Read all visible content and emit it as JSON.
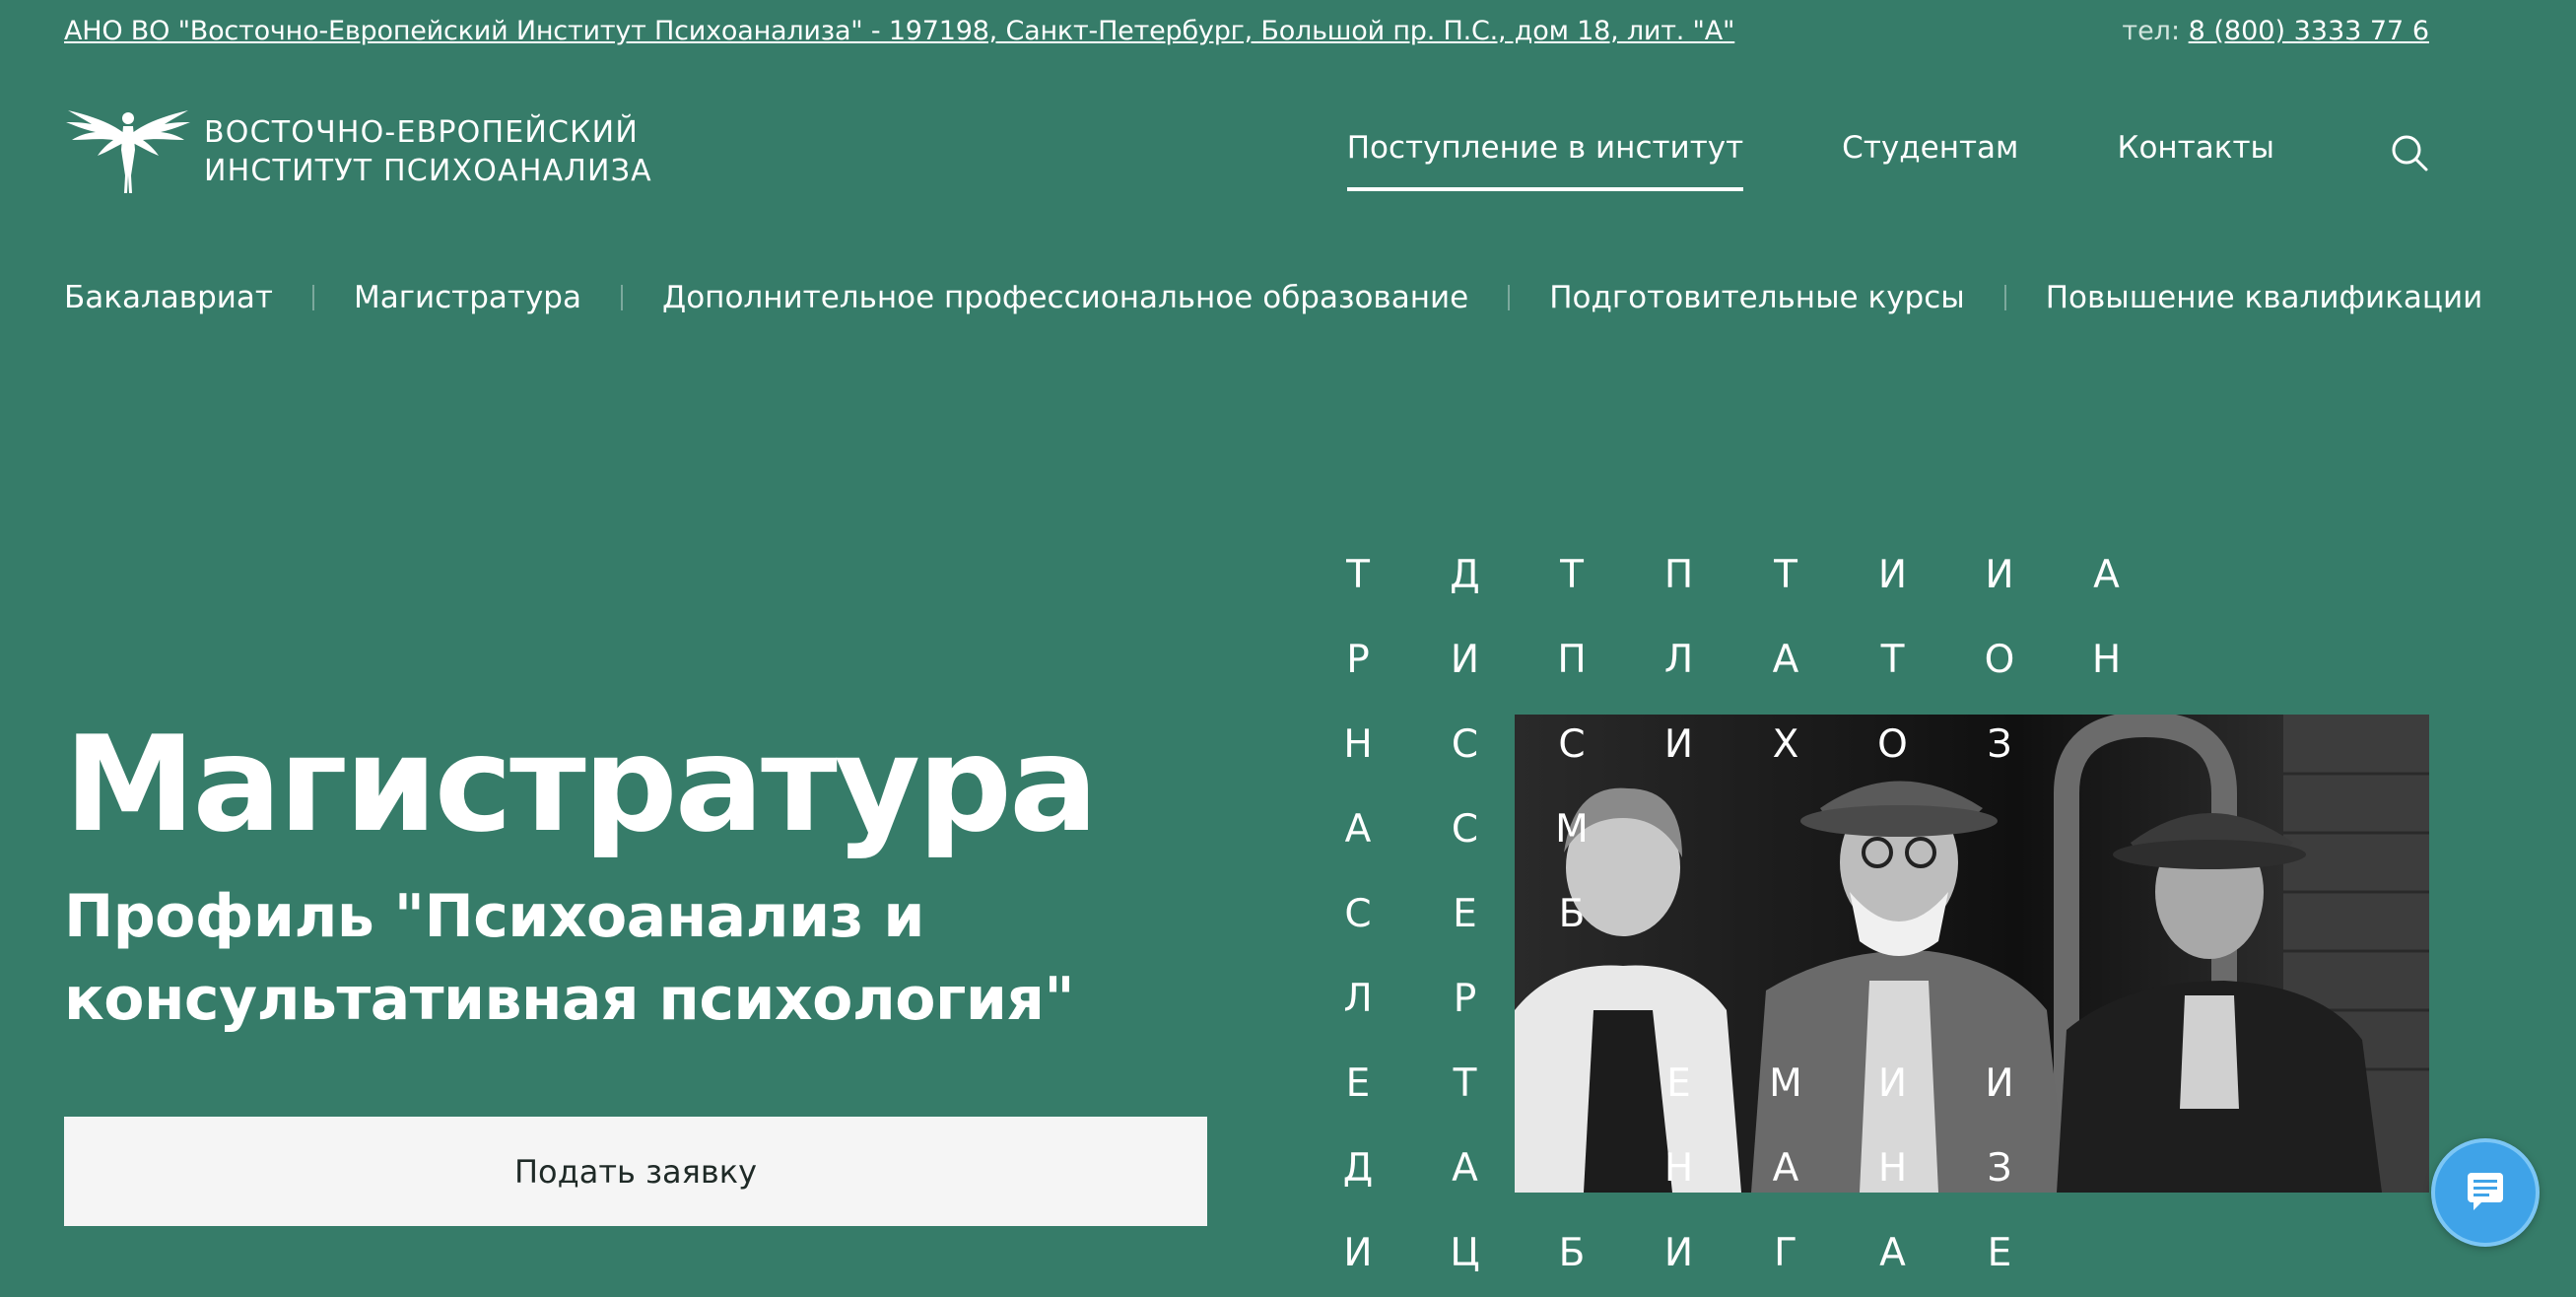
{
  "topbar": {
    "address": "АНО ВО \"Восточно-Европейский Институт Психоанализа\" - 197198, Санкт-Петербург, Большой пр. П.С., дом 18, лит. \"А\"",
    "phone_label": "тел:",
    "phone": "8 (800) 3333 77 6"
  },
  "logo": {
    "icon": "winged-figure-icon",
    "line1": "Восточно-Европейский",
    "line2": "Институт психоанализа"
  },
  "nav": {
    "items": [
      {
        "label": "Поступление в институт",
        "active": true
      },
      {
        "label": "Студентам",
        "active": false
      },
      {
        "label": "Контакты",
        "active": false
      }
    ],
    "search_icon": "search-icon"
  },
  "subnav": {
    "items": [
      "Бакалавриат",
      "Магистратура",
      "Дополнительное профессиональное образование",
      "Подготовительные курсы",
      "Повышение квалификации"
    ]
  },
  "hero": {
    "title": "Магистратура",
    "subtitle": "Профиль \"Психоанализ и консультативная психология\"",
    "button": "Подать заявку"
  },
  "letters": {
    "rows": [
      [
        "Т",
        "Д",
        "Т",
        "П",
        "Т",
        "И",
        "И",
        "А"
      ],
      [
        "Р",
        "И",
        "П",
        "Л",
        "А",
        "Т",
        "О",
        "Н"
      ],
      [
        "Н",
        "С",
        "С",
        "И",
        "Х",
        "О",
        "З",
        ""
      ],
      [
        "А",
        "С",
        "М",
        "",
        "",
        "",
        "",
        ""
      ],
      [
        "С",
        "Е",
        "Б",
        "",
        "",
        "",
        "",
        ""
      ],
      [
        "Л",
        "Р",
        "",
        "",
        "",
        "",
        "",
        ""
      ],
      [
        "Е",
        "Т",
        "",
        "Е",
        "М",
        "И",
        "И",
        ""
      ],
      [
        "Д",
        "А",
        "",
        "Н",
        "А",
        "Н",
        "З",
        ""
      ],
      [
        "И",
        "Ц",
        "Б",
        "И",
        "Г",
        "А",
        "Е",
        ""
      ]
    ]
  },
  "colors": {
    "background": "#367c69",
    "button_bg": "#f5f5f5",
    "chat_bg": "#3fa3e8"
  },
  "chat": {
    "icon": "chat-icon"
  }
}
